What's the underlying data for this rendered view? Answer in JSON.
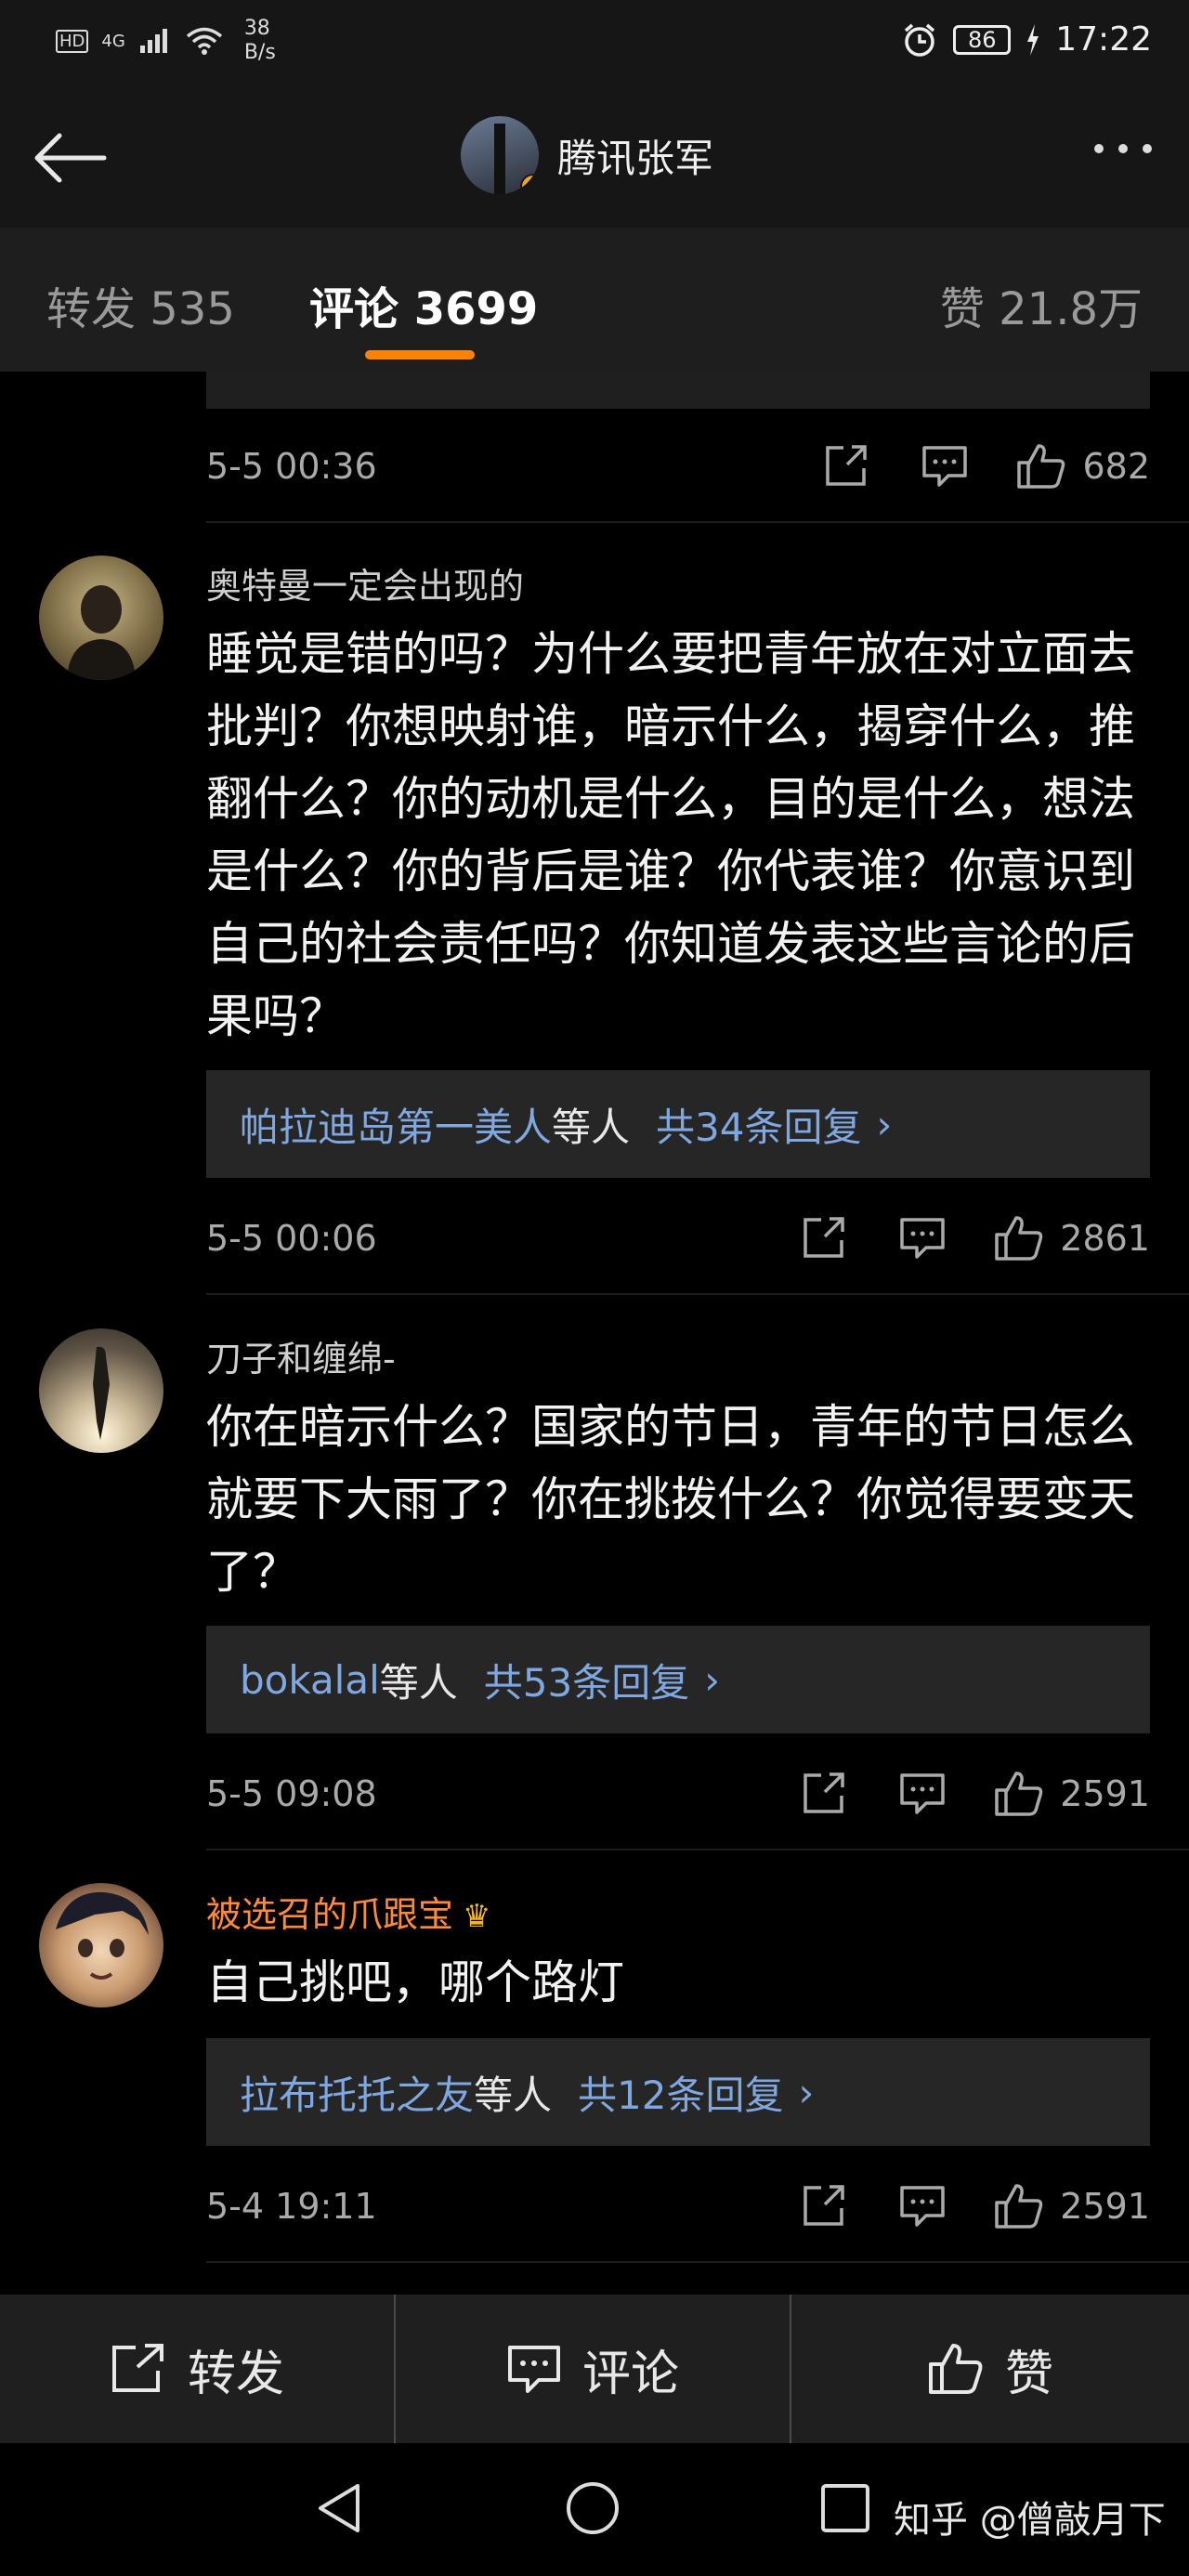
{
  "status_bar": {
    "network_labels": [
      "HD",
      "4G"
    ],
    "speed_value": "38",
    "speed_unit": "B/s",
    "battery": "86",
    "time": "17:22"
  },
  "header": {
    "title": "腾讯张军",
    "verified_badge": "v"
  },
  "tabs": {
    "repost": "转发 535",
    "comments": "评论 3699",
    "likes": "赞 21.8万"
  },
  "comments": [
    {
      "date": "5-5 00:36",
      "likes": "682"
    },
    {
      "username": "奥特曼一定会出现的",
      "text": "睡觉是错的吗？为什么要把青年放在对立面去批判？你想映射谁，暗示什么，揭穿什么，推翻什么？你的动机是什么，目的是什么，想法是什么？你的背后是谁？你代表谁？你意识到自己的社会责任吗？你知道发表这些言论的后果吗？",
      "reply_user": "帕拉迪岛第一美人",
      "reply_etc": "等人",
      "reply_count": "共34条回复",
      "reply_arrow": "›",
      "date": "5-5 00:06",
      "likes": "2861"
    },
    {
      "username": "刀子和缠绵-",
      "text": "你在暗示什么？国家的节日，青年的节日怎么就要下大雨了？你在挑拨什么？你觉得要变天了？",
      "reply_user": "bokalal",
      "reply_etc": "等人",
      "reply_count": "共53条回复",
      "reply_arrow": "›",
      "date": "5-5 09:08",
      "likes": "2591"
    },
    {
      "username": "被选召的爪跟宝",
      "badge": "♛",
      "text": "自己挑吧，哪个路灯",
      "reply_user": "拉布托托之友",
      "reply_etc": "等人",
      "reply_count": "共12条回复",
      "reply_arrow": "›",
      "date": "5-4 19:11",
      "likes": "2591"
    }
  ],
  "bottom_bar": {
    "repost": "转发",
    "comment": "评论",
    "like": "赞"
  },
  "watermark": "知乎 @僧敲月下",
  "colors": {
    "accent": "#ff8200",
    "link": "#7fa7e0",
    "vip_name": "#ff8a3d"
  }
}
